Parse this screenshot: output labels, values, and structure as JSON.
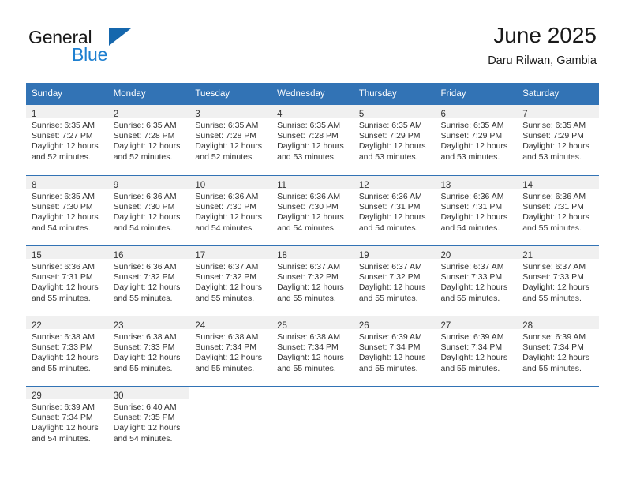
{
  "brand": {
    "name_part1": "General",
    "name_part2": "Blue"
  },
  "header": {
    "title": "June 2025",
    "subtitle": "Daru Rilwan, Gambia"
  },
  "colors": {
    "header_blue": "#3273b5",
    "brand_blue": "#1d7fd0",
    "daynum_band": "#f0f0f0",
    "text": "#333333"
  },
  "weekday_headers": [
    "Sunday",
    "Monday",
    "Tuesday",
    "Wednesday",
    "Thursday",
    "Friday",
    "Saturday"
  ],
  "weeks": [
    [
      {
        "day": "1",
        "sunrise": "Sunrise: 6:35 AM",
        "sunset": "Sunset: 7:27 PM",
        "daylight1": "Daylight: 12 hours",
        "daylight2": "and 52 minutes."
      },
      {
        "day": "2",
        "sunrise": "Sunrise: 6:35 AM",
        "sunset": "Sunset: 7:28 PM",
        "daylight1": "Daylight: 12 hours",
        "daylight2": "and 52 minutes."
      },
      {
        "day": "3",
        "sunrise": "Sunrise: 6:35 AM",
        "sunset": "Sunset: 7:28 PM",
        "daylight1": "Daylight: 12 hours",
        "daylight2": "and 52 minutes."
      },
      {
        "day": "4",
        "sunrise": "Sunrise: 6:35 AM",
        "sunset": "Sunset: 7:28 PM",
        "daylight1": "Daylight: 12 hours",
        "daylight2": "and 53 minutes."
      },
      {
        "day": "5",
        "sunrise": "Sunrise: 6:35 AM",
        "sunset": "Sunset: 7:29 PM",
        "daylight1": "Daylight: 12 hours",
        "daylight2": "and 53 minutes."
      },
      {
        "day": "6",
        "sunrise": "Sunrise: 6:35 AM",
        "sunset": "Sunset: 7:29 PM",
        "daylight1": "Daylight: 12 hours",
        "daylight2": "and 53 minutes."
      },
      {
        "day": "7",
        "sunrise": "Sunrise: 6:35 AM",
        "sunset": "Sunset: 7:29 PM",
        "daylight1": "Daylight: 12 hours",
        "daylight2": "and 53 minutes."
      }
    ],
    [
      {
        "day": "8",
        "sunrise": "Sunrise: 6:35 AM",
        "sunset": "Sunset: 7:30 PM",
        "daylight1": "Daylight: 12 hours",
        "daylight2": "and 54 minutes."
      },
      {
        "day": "9",
        "sunrise": "Sunrise: 6:36 AM",
        "sunset": "Sunset: 7:30 PM",
        "daylight1": "Daylight: 12 hours",
        "daylight2": "and 54 minutes."
      },
      {
        "day": "10",
        "sunrise": "Sunrise: 6:36 AM",
        "sunset": "Sunset: 7:30 PM",
        "daylight1": "Daylight: 12 hours",
        "daylight2": "and 54 minutes."
      },
      {
        "day": "11",
        "sunrise": "Sunrise: 6:36 AM",
        "sunset": "Sunset: 7:30 PM",
        "daylight1": "Daylight: 12 hours",
        "daylight2": "and 54 minutes."
      },
      {
        "day": "12",
        "sunrise": "Sunrise: 6:36 AM",
        "sunset": "Sunset: 7:31 PM",
        "daylight1": "Daylight: 12 hours",
        "daylight2": "and 54 minutes."
      },
      {
        "day": "13",
        "sunrise": "Sunrise: 6:36 AM",
        "sunset": "Sunset: 7:31 PM",
        "daylight1": "Daylight: 12 hours",
        "daylight2": "and 54 minutes."
      },
      {
        "day": "14",
        "sunrise": "Sunrise: 6:36 AM",
        "sunset": "Sunset: 7:31 PM",
        "daylight1": "Daylight: 12 hours",
        "daylight2": "and 55 minutes."
      }
    ],
    [
      {
        "day": "15",
        "sunrise": "Sunrise: 6:36 AM",
        "sunset": "Sunset: 7:31 PM",
        "daylight1": "Daylight: 12 hours",
        "daylight2": "and 55 minutes."
      },
      {
        "day": "16",
        "sunrise": "Sunrise: 6:36 AM",
        "sunset": "Sunset: 7:32 PM",
        "daylight1": "Daylight: 12 hours",
        "daylight2": "and 55 minutes."
      },
      {
        "day": "17",
        "sunrise": "Sunrise: 6:37 AM",
        "sunset": "Sunset: 7:32 PM",
        "daylight1": "Daylight: 12 hours",
        "daylight2": "and 55 minutes."
      },
      {
        "day": "18",
        "sunrise": "Sunrise: 6:37 AM",
        "sunset": "Sunset: 7:32 PM",
        "daylight1": "Daylight: 12 hours",
        "daylight2": "and 55 minutes."
      },
      {
        "day": "19",
        "sunrise": "Sunrise: 6:37 AM",
        "sunset": "Sunset: 7:32 PM",
        "daylight1": "Daylight: 12 hours",
        "daylight2": "and 55 minutes."
      },
      {
        "day": "20",
        "sunrise": "Sunrise: 6:37 AM",
        "sunset": "Sunset: 7:33 PM",
        "daylight1": "Daylight: 12 hours",
        "daylight2": "and 55 minutes."
      },
      {
        "day": "21",
        "sunrise": "Sunrise: 6:37 AM",
        "sunset": "Sunset: 7:33 PM",
        "daylight1": "Daylight: 12 hours",
        "daylight2": "and 55 minutes."
      }
    ],
    [
      {
        "day": "22",
        "sunrise": "Sunrise: 6:38 AM",
        "sunset": "Sunset: 7:33 PM",
        "daylight1": "Daylight: 12 hours",
        "daylight2": "and 55 minutes."
      },
      {
        "day": "23",
        "sunrise": "Sunrise: 6:38 AM",
        "sunset": "Sunset: 7:33 PM",
        "daylight1": "Daylight: 12 hours",
        "daylight2": "and 55 minutes."
      },
      {
        "day": "24",
        "sunrise": "Sunrise: 6:38 AM",
        "sunset": "Sunset: 7:34 PM",
        "daylight1": "Daylight: 12 hours",
        "daylight2": "and 55 minutes."
      },
      {
        "day": "25",
        "sunrise": "Sunrise: 6:38 AM",
        "sunset": "Sunset: 7:34 PM",
        "daylight1": "Daylight: 12 hours",
        "daylight2": "and 55 minutes."
      },
      {
        "day": "26",
        "sunrise": "Sunrise: 6:39 AM",
        "sunset": "Sunset: 7:34 PM",
        "daylight1": "Daylight: 12 hours",
        "daylight2": "and 55 minutes."
      },
      {
        "day": "27",
        "sunrise": "Sunrise: 6:39 AM",
        "sunset": "Sunset: 7:34 PM",
        "daylight1": "Daylight: 12 hours",
        "daylight2": "and 55 minutes."
      },
      {
        "day": "28",
        "sunrise": "Sunrise: 6:39 AM",
        "sunset": "Sunset: 7:34 PM",
        "daylight1": "Daylight: 12 hours",
        "daylight2": "and 55 minutes."
      }
    ],
    [
      {
        "day": "29",
        "sunrise": "Sunrise: 6:39 AM",
        "sunset": "Sunset: 7:34 PM",
        "daylight1": "Daylight: 12 hours",
        "daylight2": "and 54 minutes."
      },
      {
        "day": "30",
        "sunrise": "Sunrise: 6:40 AM",
        "sunset": "Sunset: 7:35 PM",
        "daylight1": "Daylight: 12 hours",
        "daylight2": "and 54 minutes."
      },
      {
        "day": "",
        "sunrise": "",
        "sunset": "",
        "daylight1": "",
        "daylight2": ""
      },
      {
        "day": "",
        "sunrise": "",
        "sunset": "",
        "daylight1": "",
        "daylight2": ""
      },
      {
        "day": "",
        "sunrise": "",
        "sunset": "",
        "daylight1": "",
        "daylight2": ""
      },
      {
        "day": "",
        "sunrise": "",
        "sunset": "",
        "daylight1": "",
        "daylight2": ""
      },
      {
        "day": "",
        "sunrise": "",
        "sunset": "",
        "daylight1": "",
        "daylight2": ""
      }
    ]
  ]
}
